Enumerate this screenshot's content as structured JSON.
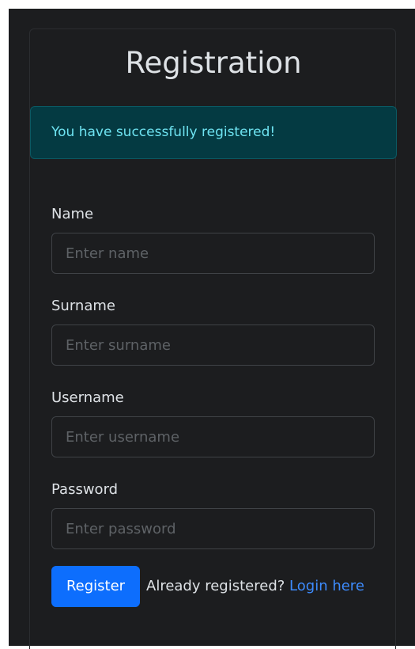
{
  "page": {
    "title": "Registration"
  },
  "alert": {
    "message": "You have successfully registered!"
  },
  "form": {
    "name": {
      "label": "Name",
      "placeholder": "Enter name",
      "value": ""
    },
    "surname": {
      "label": "Surname",
      "placeholder": "Enter surname",
      "value": ""
    },
    "username": {
      "label": "Username",
      "placeholder": "Enter username",
      "value": ""
    },
    "password": {
      "label": "Password",
      "placeholder": "Enter password",
      "value": ""
    },
    "submit_label": "Register"
  },
  "footer": {
    "prompt": "Already registered?",
    "link_label": "Login here"
  },
  "colors": {
    "background": "#1c1d1f",
    "alert_bg": "#043a42",
    "alert_text": "#6ee3f1",
    "primary": "#0d6efd",
    "link": "#3d8bfd"
  }
}
